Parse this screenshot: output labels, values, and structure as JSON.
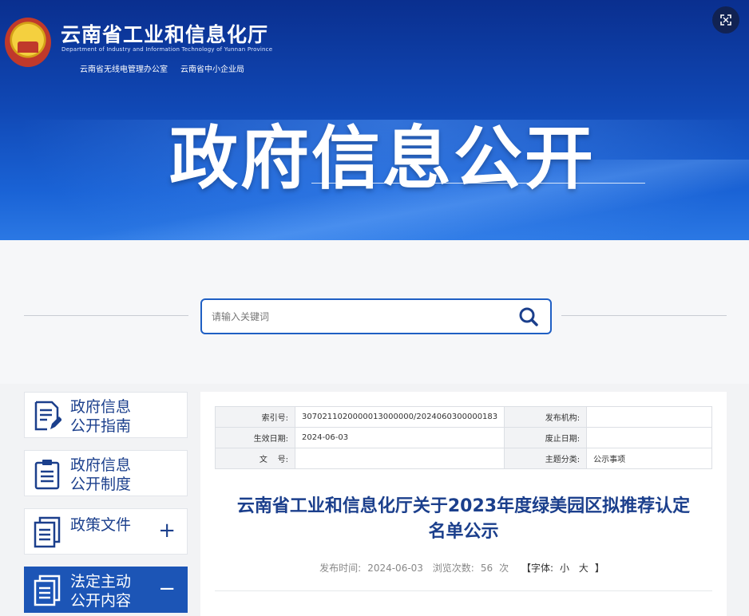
{
  "header": {
    "org_name": "云南省工业和信息化厅",
    "org_en": "Department of Industry and Information Technology of Yunnan Province",
    "sub_orgs": [
      "云南省无线电管理办公室",
      "云南省中小企业局"
    ],
    "banner_title": "政府信息公开"
  },
  "search": {
    "placeholder": "请输入关键词"
  },
  "sidebar": {
    "items": [
      {
        "line1": "政府信息",
        "line2": "公开指南",
        "toggle": ""
      },
      {
        "line1": "政府信息",
        "line2": "公开制度",
        "toggle": ""
      },
      {
        "line1": "政策文件",
        "line2": "",
        "toggle": "+"
      },
      {
        "line1": "法定主动",
        "line2": "公开内容",
        "toggle": "−"
      }
    ]
  },
  "meta_table": {
    "index_label": "索引号:",
    "index_value": "3070211020000013000000/2024060300000183",
    "publisher_label": "发布机构:",
    "publisher_value": "",
    "effective_label": "生效日期:",
    "effective_value": "2024-06-03",
    "expire_label": "废止日期:",
    "expire_value": "",
    "docno_label": "文    号:",
    "docno_value": "",
    "category_label": "主题分类:",
    "category_value": "公示事项"
  },
  "article": {
    "title_line1": "云南省工业和信息化厅关于2023年度绿美园区拟推荐认定",
    "title_line2": "名单公示",
    "publish_label": "发布时间:",
    "publish_date": "2024-06-03",
    "views_label": "浏览次数:",
    "views_count": "56",
    "views_unit": "次",
    "font_open": "【字体:",
    "font_small": "小",
    "font_large": "大",
    "font_close": "】"
  },
  "colors": {
    "accent": "#1c55b6",
    "title_blue": "#1b3f8c"
  }
}
